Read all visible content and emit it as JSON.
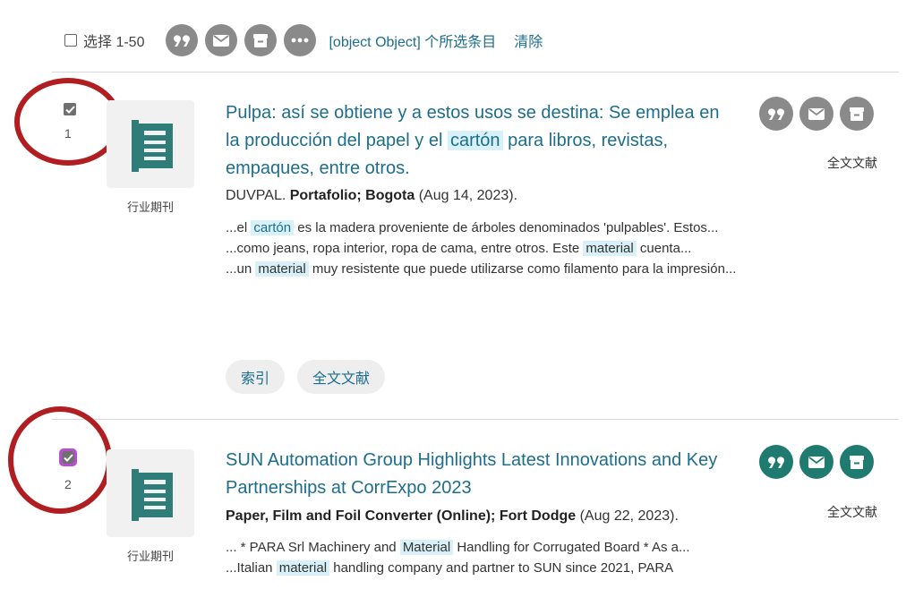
{
  "toolbar": {
    "select_label": "选择 1-50",
    "selected_text": "[object Object] 个所选条目",
    "clear_label": "清除",
    "icons": [
      "cite-icon",
      "email-icon",
      "save-icon",
      "more-icon"
    ],
    "icon_color": "#8a8a8a"
  },
  "records": [
    {
      "number": "1",
      "checked": true,
      "doc_type": "行业期刊",
      "title_parts": [
        "Pulpa: así se obtiene y a estos usos se destina: Se emplea en la producción del papel y el ",
        "cartón",
        " para libros, revistas, empaques, entre otros."
      ],
      "source_plain": "DUVPAL. ",
      "source_bold": "Portafolio; Bogota",
      "source_date": " (Aug 14, 2023).",
      "snippets": [
        [
          "...el ",
          "cartón",
          " es la madera proveniente de árboles denominados 'pulpables'. Estos..."
        ],
        [
          "...como jeans, ropa interior, ropa de cama, entre otros. Este ",
          "material",
          " cuenta..."
        ],
        [
          "...un ",
          "material",
          " muy resistente que puede utilizarse como filamento para la impresión..."
        ]
      ],
      "fulltext_label": "全文文献",
      "buttons": [
        "索引",
        "全文文献"
      ],
      "icon_color": "#8a8a8a"
    },
    {
      "number": "2",
      "checked": true,
      "doc_type": "行业期刊",
      "title": "SUN Automation Group Highlights Latest Innovations and Key Partnerships at CorrExpo 2023",
      "source_bold": "Paper, Film and Foil Converter (Online); Fort Dodge",
      "source_date": " (Aug 22, 2023).",
      "snippets": [
        [
          "... * PARA Srl Machinery and ",
          "Material",
          " Handling for Corrugated Board * As a..."
        ],
        [
          "...Italian ",
          "material",
          " handling company and partner to SUN since 2021, PARA"
        ]
      ],
      "fulltext_label": "全文文献",
      "icon_color": "#1f7a6f"
    }
  ],
  "colors": {
    "link": "#1d6e8c",
    "highlight": "#d8f1f8",
    "annotation_ring": "#b01e22",
    "checkbox_focus": "#b94bd6"
  }
}
